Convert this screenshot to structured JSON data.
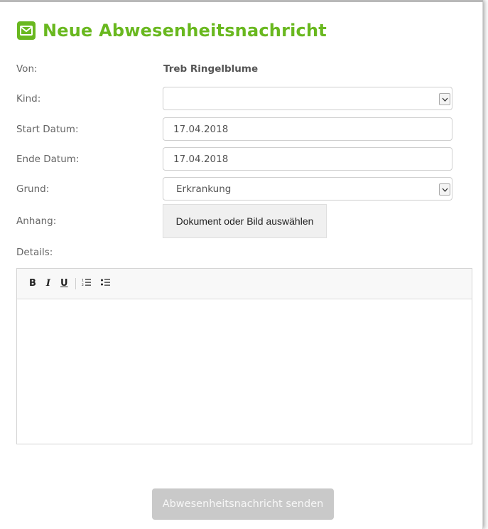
{
  "page": {
    "title": "Neue Abwesenheitsnachricht",
    "title_icon": "envelope-icon",
    "accent_color": "#69b81f"
  },
  "form": {
    "von_label": "Von:",
    "von_value": "Treb Ringelblume",
    "kind_label": "Kind:",
    "kind_value": "",
    "start_label": "Start Datum:",
    "start_value": "17.04.2018",
    "ende_label": "Ende Datum:",
    "ende_value": "17.04.2018",
    "grund_label": "Grund:",
    "grund_value": "Erkrankung",
    "anhang_label": "Anhang:",
    "anhang_button": "Dokument oder Bild auswählen",
    "details_label": "Details:"
  },
  "editor": {
    "toolbar": {
      "bold": "B",
      "italic": "I",
      "underline": "U",
      "ordered_list_icon": "ordered-list-icon",
      "unordered_list_icon": "unordered-list-icon"
    },
    "content": ""
  },
  "submit": {
    "label": "Abwesenheitsnachricht senden",
    "state": "disabled"
  }
}
